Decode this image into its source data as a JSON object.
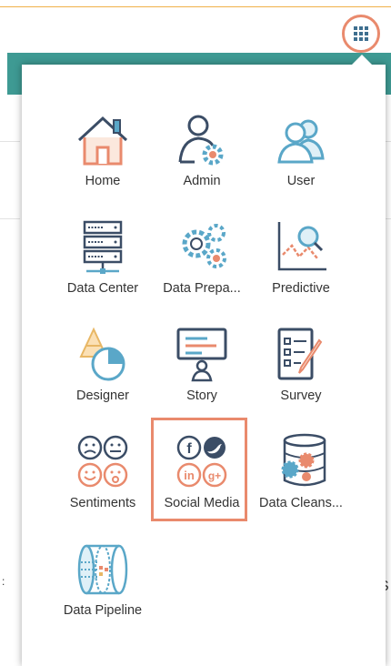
{
  "header": {
    "app_launcher_icon": "grid-icon",
    "accent_color": "#e98a6d",
    "bar_color": "#3e9a93"
  },
  "menu": {
    "items": [
      {
        "label": "Home",
        "icon": "home-icon"
      },
      {
        "label": "Admin",
        "icon": "admin-icon"
      },
      {
        "label": "User",
        "icon": "user-icon"
      },
      {
        "label": "Data Center",
        "icon": "data-center-icon"
      },
      {
        "label": "Data Prepa...",
        "icon": "data-preparation-icon"
      },
      {
        "label": "Predictive",
        "icon": "predictive-icon"
      },
      {
        "label": "Designer",
        "icon": "designer-icon"
      },
      {
        "label": "Story",
        "icon": "story-icon"
      },
      {
        "label": "Survey",
        "icon": "survey-icon"
      },
      {
        "label": "Sentiments",
        "icon": "sentiments-icon"
      },
      {
        "label": "Social Media",
        "icon": "social-media-icon"
      },
      {
        "label": "Data Cleans...",
        "icon": "data-cleansing-icon"
      },
      {
        "label": "Data Pipeline",
        "icon": "data-pipeline-icon"
      }
    ],
    "highlighted_item": "Social Media"
  },
  "background": {
    "left_glyph": ":",
    "right_glyph": "S"
  }
}
